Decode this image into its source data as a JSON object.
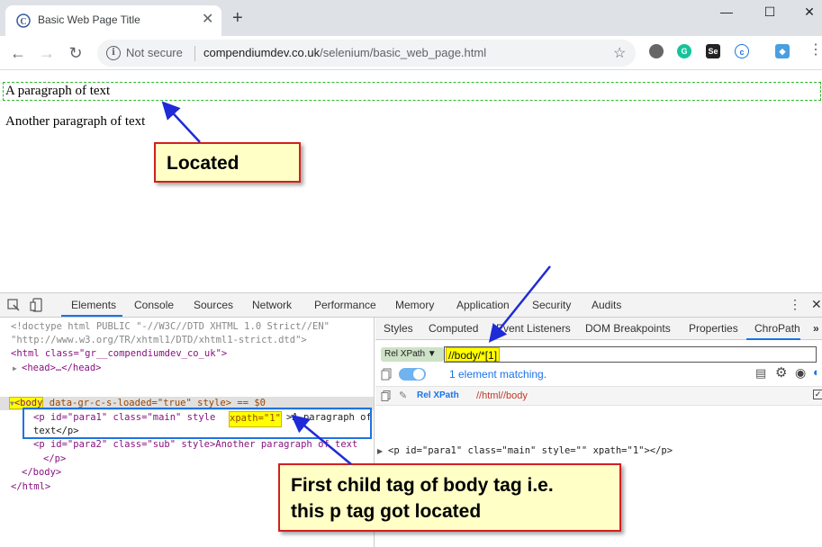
{
  "browser": {
    "tab_title": "Basic Web Page Title",
    "tab_close": "✕",
    "new_tab": "+",
    "security_label": "Not secure",
    "url_host": "compendiumdev.co.uk",
    "url_path": "/selenium/basic_web_page.html",
    "window_controls": [
      "—",
      "☐",
      "✕"
    ]
  },
  "page": {
    "paragraph_1": "A paragraph of text",
    "paragraph_2": "Another paragraph of text"
  },
  "callouts": {
    "located": "Located",
    "explanation_line1": "First child tag of body tag i.e.",
    "explanation_line2": "this p tag got located"
  },
  "devtools": {
    "tabs": [
      "Elements",
      "Console",
      "Sources",
      "Network",
      "Performance",
      "Memory",
      "Application",
      "Security",
      "Audits"
    ],
    "side_tabs": [
      "Styles",
      "Computed",
      "Event Listeners",
      "DOM Breakpoints",
      "Properties",
      "ChroPath"
    ],
    "xpath_type": "Rel XPath",
    "xpath_query": "//body/*[1]",
    "match_status": "1 element matching.",
    "result_label": "Rel XPath",
    "result_value": "//html//body",
    "result_node": "<p id=\"para1\" class=\"main\" style=\"\" xpath=\"1\"></p>",
    "code": {
      "doctype1": "<!doctype html PUBLIC \"-//W3C//DTD XHTML 1.0 Strict//EN\"",
      "doctype2": "\"http://www.w3.org/TR/xhtml1/DTD/xhtml1-strict.dtd\">",
      "html_open": "<html class=\"gr__compendiumdev_co_uk\">",
      "head": "<head>…</head>",
      "body_tag": "<body",
      "body_rest": " data-gr-c-s-loaded=\"true\" style> == $0",
      "p1_open": "<p id=\"para1\" class=\"main\" style ",
      "p1_xpath": "xpath=\"1\"",
      "p1_text": ">A paragraph of",
      "p1_close": "text</p>",
      "p2_line": "<p id=\"para2\" class=\"sub\" style>Another paragraph of text",
      "p2_close": "</p>",
      "body_close": "</body>",
      "html_close": "</html>"
    }
  },
  "colors": {
    "annotation_blue": "#1f2bd6",
    "callout_border": "#d22020",
    "callout_fill": "#ffffc6",
    "selection_green": "#2eb82e"
  }
}
